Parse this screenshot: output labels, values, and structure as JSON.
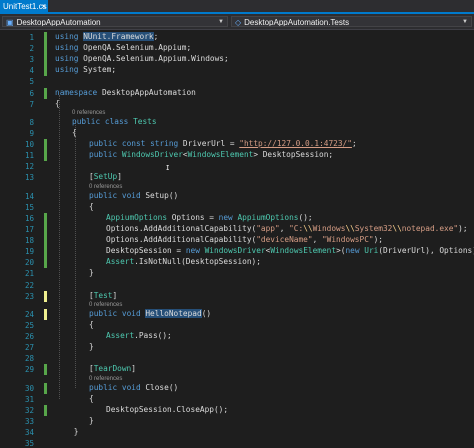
{
  "tabs": {
    "active": {
      "label": "UnitTest1.cs",
      "close_glyph": "×"
    }
  },
  "nav": {
    "project": "DesktopAppAutomation",
    "class": "DesktopAppAutomation.Tests"
  },
  "code": [
    {
      "n": "1",
      "g": "green",
      "ind": 0,
      "segs": [
        {
          "t": "using",
          "c": "kw"
        },
        {
          "t": " "
        },
        {
          "t": "NUnit.",
          "c": "hl"
        },
        {
          "t": "Framework",
          "c": "hl"
        },
        {
          "t": ";"
        }
      ]
    },
    {
      "n": "2",
      "g": "green",
      "ind": 0,
      "segs": [
        {
          "t": "using",
          "c": "kw"
        },
        {
          "t": " OpenQA.Selenium.Appium;"
        }
      ]
    },
    {
      "n": "3",
      "g": "green",
      "ind": 0,
      "segs": [
        {
          "t": "using",
          "c": "kw"
        },
        {
          "t": " OpenQA.Selenium.Appium.Windows;"
        }
      ]
    },
    {
      "n": "4",
      "g": "green",
      "ind": 0,
      "segs": [
        {
          "t": "using",
          "c": "kw"
        },
        {
          "t": " System;"
        }
      ]
    },
    {
      "n": "5",
      "ind": 0,
      "segs": []
    },
    {
      "n": "6",
      "g": "green",
      "ind": 0,
      "segs": [
        {
          "t": "namespace",
          "c": "kw"
        },
        {
          "t": " DesktopAppAutomation"
        }
      ]
    },
    {
      "n": "7",
      "ind": 0,
      "segs": [
        {
          "t": "{"
        }
      ]
    },
    {
      "ref": "0 references",
      "ind": 1
    },
    {
      "n": "8",
      "ind": 1,
      "segs": [
        {
          "t": "public",
          "c": "kw"
        },
        {
          "t": " "
        },
        {
          "t": "class",
          "c": "kw"
        },
        {
          "t": " "
        },
        {
          "t": "Tests",
          "c": "ty"
        }
      ]
    },
    {
      "n": "9",
      "ind": 1,
      "segs": [
        {
          "t": "{"
        }
      ]
    },
    {
      "n": "10",
      "g": "green",
      "ind": 2,
      "segs": [
        {
          "t": "public",
          "c": "kw"
        },
        {
          "t": " "
        },
        {
          "t": "const",
          "c": "kw"
        },
        {
          "t": " "
        },
        {
          "t": "string",
          "c": "kw"
        },
        {
          "t": " DriverUrl = "
        },
        {
          "t": "\"http://127.0.0.1:4723/\"",
          "c": "st lk"
        },
        {
          "t": ";"
        }
      ]
    },
    {
      "n": "11",
      "g": "green",
      "ind": 2,
      "segs": [
        {
          "t": "public",
          "c": "kw"
        },
        {
          "t": " "
        },
        {
          "t": "WindowsDriver",
          "c": "ty"
        },
        {
          "t": "<"
        },
        {
          "t": "WindowsElement",
          "c": "ty"
        },
        {
          "t": "> DesktopSession;"
        }
      ]
    },
    {
      "n": "12",
      "ind": 0,
      "segs": []
    },
    {
      "n": "13",
      "ind": 2,
      "segs": [
        {
          "t": "["
        },
        {
          "t": "SetUp",
          "c": "ty"
        },
        {
          "t": "]"
        }
      ]
    },
    {
      "ref": "0 references",
      "ind": 2
    },
    {
      "n": "14",
      "ind": 2,
      "segs": [
        {
          "t": "public",
          "c": "kw"
        },
        {
          "t": " "
        },
        {
          "t": "void",
          "c": "kw"
        },
        {
          "t": " Setup()"
        }
      ]
    },
    {
      "n": "15",
      "ind": 2,
      "segs": [
        {
          "t": "{"
        }
      ]
    },
    {
      "n": "16",
      "g": "green",
      "ind": 3,
      "segs": [
        {
          "t": "AppiumOptions",
          "c": "ty"
        },
        {
          "t": " Options = "
        },
        {
          "t": "new",
          "c": "kw"
        },
        {
          "t": " "
        },
        {
          "t": "AppiumOptions",
          "c": "ty"
        },
        {
          "t": "();"
        }
      ]
    },
    {
      "n": "17",
      "g": "green",
      "ind": 3,
      "segs": [
        {
          "t": "Options.AddAdditionalCapability("
        },
        {
          "t": "\"app\"",
          "c": "st"
        },
        {
          "t": ", "
        },
        {
          "t": "\"C:",
          "c": "st"
        },
        {
          "t": "\\\\",
          "c": "sc"
        },
        {
          "t": "Windows",
          "c": "st"
        },
        {
          "t": "\\\\",
          "c": "sc"
        },
        {
          "t": "System32",
          "c": "st"
        },
        {
          "t": "\\\\",
          "c": "sc"
        },
        {
          "t": "notepad.exe\"",
          "c": "st"
        },
        {
          "t": ");"
        }
      ]
    },
    {
      "n": "18",
      "g": "green",
      "ind": 3,
      "segs": [
        {
          "t": "Options.AddAdditionalCapability("
        },
        {
          "t": "\"deviceName\"",
          "c": "st"
        },
        {
          "t": ", "
        },
        {
          "t": "\"WindowsPC\"",
          "c": "st"
        },
        {
          "t": ");"
        }
      ]
    },
    {
      "n": "19",
      "g": "green",
      "ind": 3,
      "segs": [
        {
          "t": "DesktopSession = "
        },
        {
          "t": "new",
          "c": "kw"
        },
        {
          "t": " "
        },
        {
          "t": "WindowsDriver",
          "c": "ty"
        },
        {
          "t": "<"
        },
        {
          "t": "WindowsElement",
          "c": "ty"
        },
        {
          "t": ">("
        },
        {
          "t": "new",
          "c": "kw"
        },
        {
          "t": " "
        },
        {
          "t": "Uri",
          "c": "ty"
        },
        {
          "t": "(DriverUrl), Options);"
        }
      ]
    },
    {
      "n": "20",
      "g": "green",
      "ind": 3,
      "segs": [
        {
          "t": "Assert",
          "c": "ty"
        },
        {
          "t": ".IsNotNull(DesktopSession);"
        }
      ]
    },
    {
      "n": "21",
      "ind": 2,
      "segs": [
        {
          "t": "}"
        }
      ]
    },
    {
      "n": "22",
      "ind": 0,
      "segs": []
    },
    {
      "n": "23",
      "g": "yellow",
      "ind": 2,
      "segs": [
        {
          "t": "["
        },
        {
          "t": "Test",
          "c": "ty"
        },
        {
          "t": "]"
        }
      ]
    },
    {
      "ref": "0 references",
      "ind": 2
    },
    {
      "n": "24",
      "g": "yellow",
      "ind": 2,
      "segs": [
        {
          "t": "public",
          "c": "kw"
        },
        {
          "t": " "
        },
        {
          "t": "void",
          "c": "kw"
        },
        {
          "t": " "
        },
        {
          "t": "HelloNotepad",
          "c": "hl"
        },
        {
          "t": "()"
        }
      ]
    },
    {
      "n": "25",
      "ind": 2,
      "segs": [
        {
          "t": "{"
        }
      ]
    },
    {
      "n": "26",
      "ind": 3,
      "segs": [
        {
          "t": "Assert",
          "c": "ty"
        },
        {
          "t": ".Pass();"
        }
      ]
    },
    {
      "n": "27",
      "ind": 2,
      "segs": [
        {
          "t": "}"
        }
      ]
    },
    {
      "n": "28",
      "ind": 0,
      "segs": []
    },
    {
      "n": "29",
      "g": "green",
      "ind": 2,
      "segs": [
        {
          "t": "["
        },
        {
          "t": "TearDown",
          "c": "ty"
        },
        {
          "t": "]"
        }
      ]
    },
    {
      "ref": "0 references",
      "ind": 2
    },
    {
      "n": "30",
      "g": "green",
      "ind": 2,
      "segs": [
        {
          "t": "public",
          "c": "kw"
        },
        {
          "t": " "
        },
        {
          "t": "void",
          "c": "kw"
        },
        {
          "t": " Close()"
        }
      ]
    },
    {
      "n": "31",
      "ind": 2,
      "segs": [
        {
          "t": "{"
        }
      ]
    },
    {
      "n": "32",
      "g": "green",
      "ind": 3,
      "segs": [
        {
          "t": "DesktopSession.CloseApp();"
        }
      ]
    },
    {
      "n": "33",
      "ind": 2,
      "segs": [
        {
          "t": "}"
        }
      ]
    },
    {
      "n": "34",
      "ind": 0,
      "segs": [
        {
          "t": "    }"
        }
      ]
    },
    {
      "n": "35",
      "ind": 0,
      "segs": []
    }
  ]
}
